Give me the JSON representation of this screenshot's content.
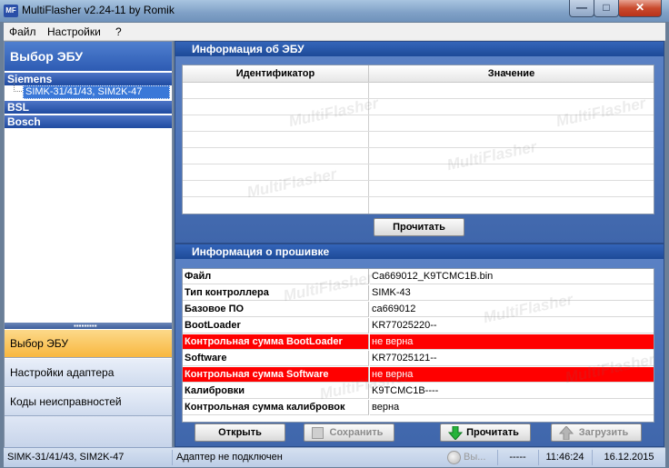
{
  "window": {
    "title": "MultiFlasher v2.24-11 by Romik",
    "icon_text": "MF",
    "min_glyph": "—",
    "max_glyph": "□",
    "close_glyph": "✕"
  },
  "menu": [
    "Файл",
    "Настройки",
    "?"
  ],
  "sidebar": {
    "header": "Выбор ЭБУ",
    "groups": [
      "Siemens",
      "BSL",
      "Bosch"
    ],
    "selected_item": "SIMK-31/41/43, SIM2K-47",
    "grip": "▪▪▪▪▪▪▪▪▪",
    "nav": [
      {
        "label": "Выбор ЭБУ",
        "active": true
      },
      {
        "label": "Настройки адаптера",
        "active": false
      },
      {
        "label": "Коды неисправностей",
        "active": false
      }
    ]
  },
  "ecu_info": {
    "title": "Информация об ЭБУ",
    "columns": [
      "Идентификатор",
      "Значение"
    ],
    "read_button": "Прочитать"
  },
  "firmware_info": {
    "title": "Информация о прошивке",
    "rows": [
      {
        "key": "Файл",
        "value": "Ca669012_K9TCMC1B.bin",
        "error": false
      },
      {
        "key": "Тип контроллера",
        "value": "SIMK-43",
        "error": false
      },
      {
        "key": "Базовое ПО",
        "value": "ca669012",
        "error": false
      },
      {
        "key": "BootLoader",
        "value": "KR77025220--",
        "error": false
      },
      {
        "key": "Контрольная сумма BootLoader",
        "value": "не верна",
        "error": true
      },
      {
        "key": "Software",
        "value": "KR77025121--",
        "error": false
      },
      {
        "key": "Контрольная сумма Software",
        "value": "не верна",
        "error": true
      },
      {
        "key": "Калибровки",
        "value": "K9TCMC1B----",
        "error": false
      },
      {
        "key": "Контрольная сумма калибровок",
        "value": "верна",
        "error": false
      }
    ],
    "buttons": {
      "open": "Открыть",
      "save": "Сохранить",
      "read": "Прочитать",
      "load": "Загрузить"
    }
  },
  "watermark": "MultiFlasher",
  "status": {
    "ecu": "SIMK-31/41/43, SIM2K-47",
    "adapter": "Адаптер не подключен",
    "mode": "Вы...",
    "dashes": "-----",
    "time": "11:46:24",
    "date": "16.12.2015"
  },
  "colors": {
    "error_row": "#ff0000",
    "accent_blue": "#2d5bb3",
    "active_nav": "#f8b73e"
  }
}
